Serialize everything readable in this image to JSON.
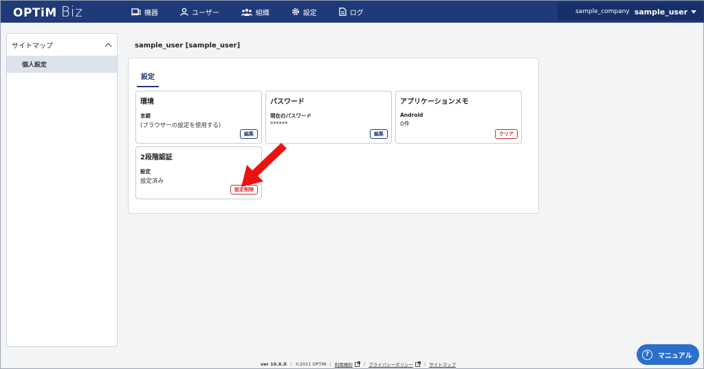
{
  "brand": {
    "optim": "OPTiM",
    "biz": "Biz"
  },
  "nav": {
    "devices": "機器",
    "users": "ユーザー",
    "organization": "組織",
    "settings": "設定",
    "log": "ログ"
  },
  "account": {
    "company": "sample_company",
    "user": "sample_user"
  },
  "sidebar": {
    "title": "サイトマップ",
    "items": [
      {
        "label": "個人設定"
      }
    ]
  },
  "main": {
    "user_title": "sample_user [sample_user]",
    "tab": "設定",
    "cards": {
      "environment": {
        "title": "環境",
        "label": "言語",
        "value": "(ブラウザーの設定を使用する)",
        "button": "編集"
      },
      "password": {
        "title": "パスワード",
        "label": "現在のパスワード",
        "value": "******",
        "button": "編集"
      },
      "app_memo": {
        "title": "アプリケーションメモ",
        "label": "Android",
        "value": "0件",
        "button": "クリア"
      },
      "two_factor": {
        "title": "2段階認証",
        "label": "設定",
        "value": "設定済み",
        "button": "設定削除"
      }
    }
  },
  "footer": {
    "version": "ver 10.X.X",
    "copyright": "©2011 OPTiM",
    "terms": "利用規約",
    "privacy": "プライバシーポリシー",
    "sitemap": "サイトマップ"
  },
  "manual": {
    "label": "マニュアル"
  },
  "colors": {
    "header": "#1f3a78",
    "accent_blue": "#1f3a78",
    "danger_red": "#cc2a2a",
    "manual_button": "#2b6fcb",
    "annotation_arrow": "#ee1111"
  }
}
